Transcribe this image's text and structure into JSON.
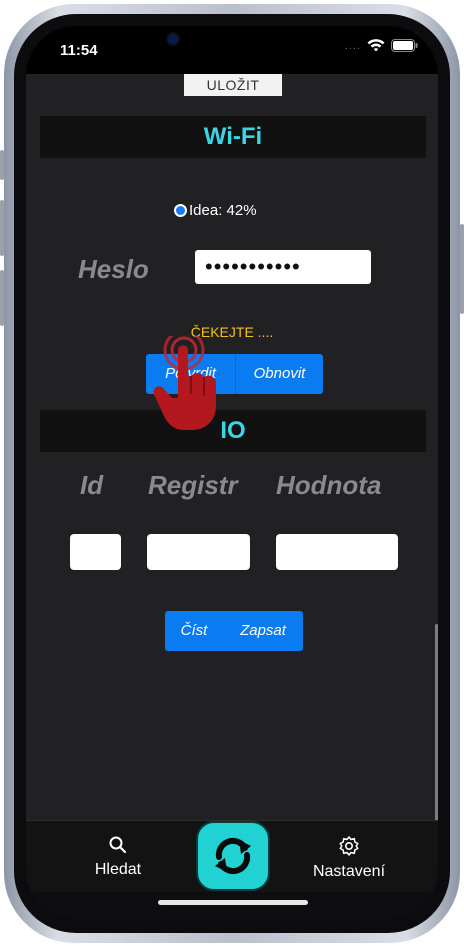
{
  "status_bar": {
    "time": "11:54",
    "signal_dots": "...."
  },
  "toolbar": {
    "save_label": "ULOŽIT"
  },
  "wifi": {
    "title": "Wi-Fi",
    "network": {
      "label": "Idea: 42%",
      "selected": true
    },
    "password_label": "Heslo",
    "password_value": "•••••••••••",
    "status": "ČEKEJTE ....",
    "confirm_label": "Potvrdit",
    "refresh_label": "Obnovit"
  },
  "io": {
    "title": "IO",
    "columns": [
      "Id",
      "Registr",
      "Hodnota"
    ],
    "read_label": "Číst",
    "write_label": "Zapsat"
  },
  "tabbar": {
    "search_label": "Hledat",
    "settings_label": "Nastavení"
  },
  "colors": {
    "accent_cyan": "#3bd6e4",
    "button_blue": "#0a7bf0",
    "warning_yellow": "#f2c417",
    "background": "#212124",
    "center_button": "#22d1d1"
  },
  "icons": [
    "search-icon",
    "sync-icon",
    "gear-icon",
    "wifi-icon",
    "battery-icon",
    "tap-hand-icon"
  ]
}
